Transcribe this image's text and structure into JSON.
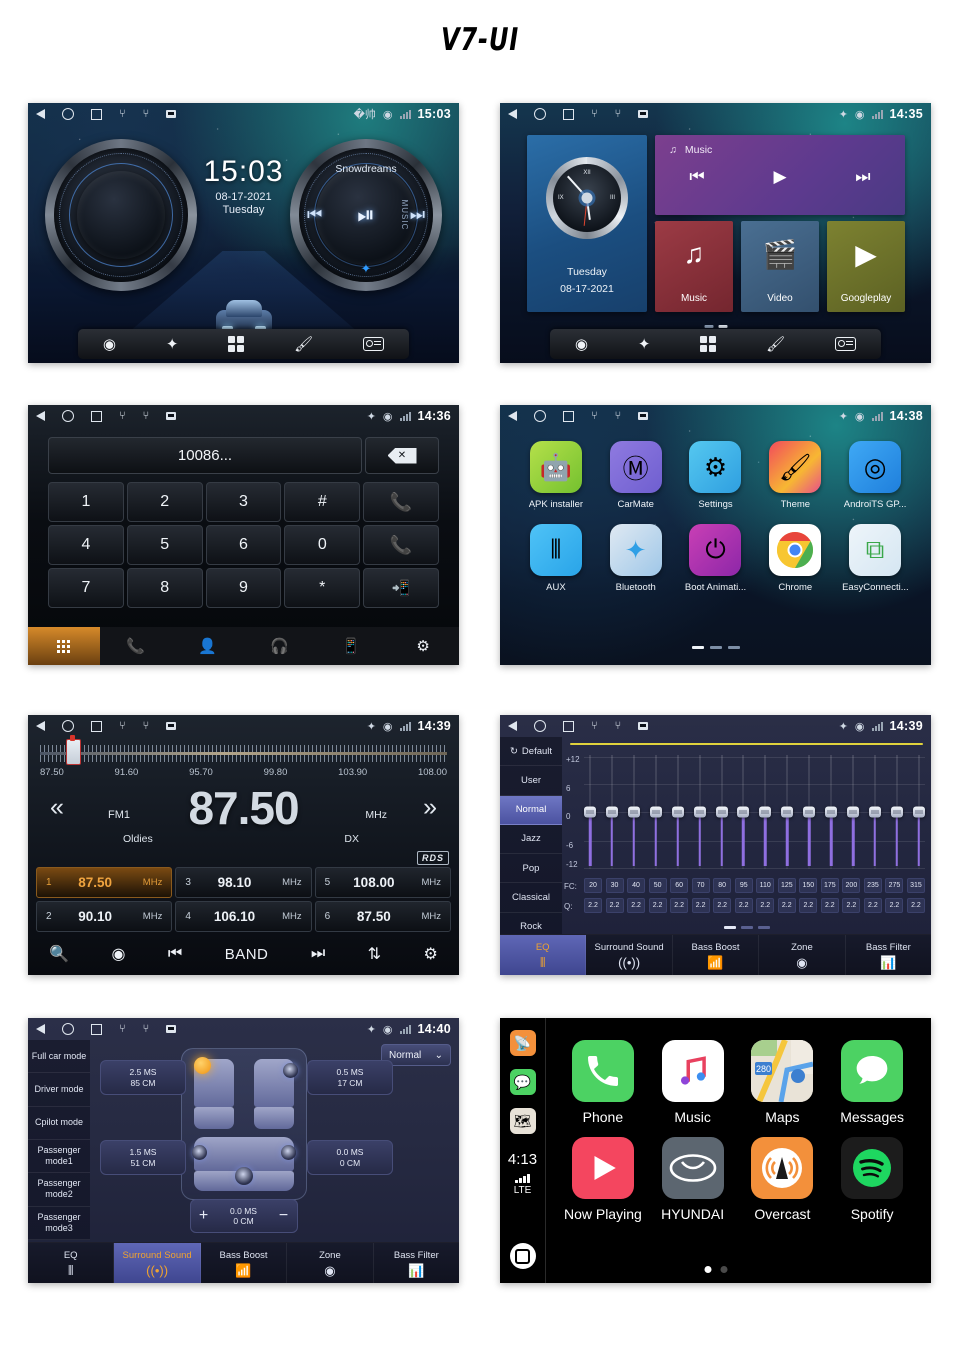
{
  "page": {
    "title": "V7-UI"
  },
  "status_icons": {
    "back": "back-triangle-icon",
    "home": "home-circle-icon",
    "recents": "recents-square-icon",
    "usb": "usb-icon",
    "sd": "sd-card-icon",
    "bluetooth": "bluetooth-icon",
    "location": "location-pin-icon",
    "signal": "signal-bars-icon"
  },
  "panels": {
    "home_knob": {
      "name": "Knob Home Screen",
      "clock_time": "15:03",
      "status_time": "15:03",
      "date": "08-17-2021",
      "weekday": "Tuesday",
      "track_title": "Snowdreams",
      "music_label": "MUSIC",
      "dock": [
        "navigation-icon",
        "bluetooth-icon",
        "apps-grid-icon",
        "theme-brush-icon",
        "radio-icon"
      ]
    },
    "home_tiles": {
      "name": "Tile Home Screen",
      "status_time": "14:35",
      "weekday": "Tuesday",
      "date": "08-17-2021",
      "clock_numerals": {
        "twelve": "XII",
        "three": "III",
        "nine": "IX"
      },
      "music_widget_label": "Music",
      "tiles": [
        {
          "label": "Music",
          "icon": "music-note-icon"
        },
        {
          "label": "Video",
          "icon": "video-clapper-icon"
        },
        {
          "label": "Googleplay",
          "icon": "play-triangle-icon"
        }
      ]
    },
    "dialer": {
      "name": "Bluetooth Dialer",
      "status_time": "14:36",
      "number": "10086...",
      "delete_icon": "backspace-icon",
      "keys": [
        "1",
        "2",
        "3",
        "#",
        "call",
        "4",
        "5",
        "6",
        "0",
        "end",
        "7",
        "8",
        "9",
        "*",
        "transfer"
      ],
      "tabs": [
        "keypad-icon",
        "call-log-icon",
        "contacts-icon",
        "bt-headset-icon",
        "bt-phone-icon",
        "bt-settings-icon"
      ]
    },
    "apps": {
      "name": "App Drawer",
      "status_time": "14:38",
      "items": [
        {
          "label": "APK installer",
          "icon": "android-robot-icon"
        },
        {
          "label": "CarMate",
          "icon": "carmate-pin-icon"
        },
        {
          "label": "Settings",
          "icon": "car-gear-icon"
        },
        {
          "label": "Theme",
          "icon": "paint-brush-icon"
        },
        {
          "label": "AndroiTS GP...",
          "icon": "gps-radar-icon"
        },
        {
          "label": "AUX",
          "icon": "aux-jack-icon"
        },
        {
          "label": "Bluetooth",
          "icon": "bluetooth-icon"
        },
        {
          "label": "Boot Animati...",
          "icon": "power-icon"
        },
        {
          "label": "Chrome",
          "icon": "chrome-icon"
        },
        {
          "label": "EasyConnecti...",
          "icon": "screen-mirror-icon"
        }
      ],
      "page_indicator": {
        "pages": 3,
        "current": 1
      }
    },
    "radio": {
      "name": "FM Radio",
      "status_time": "14:39",
      "frequency": "87.50",
      "unit": "MHz",
      "band": "FM1",
      "genre": "Oldies",
      "sensitivity": "DX",
      "rds": "RDS",
      "scale_labels": [
        "87.50",
        "91.60",
        "95.70",
        "99.80",
        "103.90",
        "108.00"
      ],
      "presets": [
        {
          "n": "1",
          "freq": "87.50",
          "unit": "MHz",
          "active": true
        },
        {
          "n": "3",
          "freq": "98.10",
          "unit": "MHz",
          "active": false
        },
        {
          "n": "5",
          "freq": "108.00",
          "unit": "MHz",
          "active": false
        },
        {
          "n": "2",
          "freq": "90.10",
          "unit": "MHz",
          "active": false
        },
        {
          "n": "4",
          "freq": "106.10",
          "unit": "MHz",
          "active": false
        },
        {
          "n": "6",
          "freq": "87.50",
          "unit": "MHz",
          "active": false
        }
      ],
      "band_button": "BAND",
      "bottom_icons": [
        "search-icon",
        "station-scan-icon",
        "prev-icon",
        "band-label",
        "next-icon",
        "equalizer-icon",
        "settings-gear-icon"
      ]
    },
    "equalizer": {
      "name": "Equalizer",
      "status_time": "14:39",
      "presets": [
        "Default",
        "User",
        "Normal",
        "Jazz",
        "Pop",
        "Classical",
        "Rock"
      ],
      "selected_preset": "Normal",
      "axis_labels": [
        "+12",
        "6",
        "0",
        "-6",
        "-12"
      ],
      "fc_label": "FC:",
      "q_label": "Q:",
      "fc_values": [
        "20",
        "30",
        "40",
        "50",
        "60",
        "70",
        "80",
        "95",
        "110",
        "125",
        "150",
        "175",
        "200",
        "235",
        "275",
        "315"
      ],
      "q_values": [
        "2.2",
        "2.2",
        "2.2",
        "2.2",
        "2.2",
        "2.2",
        "2.2",
        "2.2",
        "2.2",
        "2.2",
        "2.2",
        "2.2",
        "2.2",
        "2.2",
        "2.2",
        "2.2"
      ],
      "gain_values": [
        0,
        0,
        0,
        0,
        0,
        0,
        0,
        0,
        0,
        0,
        0,
        0,
        0,
        0,
        0,
        0
      ],
      "tabs": [
        {
          "label": "EQ",
          "icon": "eq-sliders-icon",
          "active": true
        },
        {
          "label": "Surround Sound",
          "icon": "surround-waves-icon",
          "active": false
        },
        {
          "label": "Bass Boost",
          "icon": "bass-chart-icon",
          "active": false
        },
        {
          "label": "Zone",
          "icon": "zone-target-icon",
          "active": false
        },
        {
          "label": "Bass Filter",
          "icon": "filter-bars-icon",
          "active": false
        }
      ],
      "page_indicator": {
        "pages": 3,
        "current": 1
      }
    },
    "surround": {
      "name": "Surround Sound",
      "status_time": "14:40",
      "modes": [
        "Full car mode",
        "Driver mode",
        "Cpilot mode",
        "Passenger mode1",
        "Passenger mode2",
        "Passenger mode3"
      ],
      "mode_select": "Normal",
      "delays": [
        {
          "pos": "front-left",
          "ms": "2.5 MS",
          "cm": "85 CM"
        },
        {
          "pos": "front-right",
          "ms": "0.5 MS",
          "cm": "17 CM"
        },
        {
          "pos": "rear-left",
          "ms": "1.5 MS",
          "cm": "51 CM"
        },
        {
          "pos": "rear-right",
          "ms": "0.0 MS",
          "cm": "0 CM"
        }
      ],
      "stepper": {
        "ms": "0.0 MS",
        "cm": "0 CM",
        "plus": "+",
        "minus": "−"
      },
      "tabs": [
        {
          "label": "EQ",
          "icon": "eq-sliders-icon",
          "active": false
        },
        {
          "label": "Surround Sound",
          "icon": "surround-waves-icon",
          "active": true
        },
        {
          "label": "Bass Boost",
          "icon": "bass-chart-icon",
          "active": false
        },
        {
          "label": "Zone",
          "icon": "zone-target-icon",
          "active": false
        },
        {
          "label": "Bass Filter",
          "icon": "filter-bars-icon",
          "active": false
        }
      ]
    },
    "carplay": {
      "name": "Apple CarPlay",
      "time": "4:13",
      "network": "LTE",
      "sidebar_icons": [
        "overcast-icon",
        "messages-icon",
        "maps-icon"
      ],
      "home_icon": "carplay-home-icon",
      "apps": [
        {
          "label": "Phone",
          "icon": "phone-handset-icon"
        },
        {
          "label": "Music",
          "icon": "music-note-icon"
        },
        {
          "label": "Maps",
          "icon": "maps-icon"
        },
        {
          "label": "Messages",
          "icon": "message-bubble-icon"
        },
        {
          "label": "Now Playing",
          "icon": "play-triangle-icon"
        },
        {
          "label": "HYUNDAI",
          "icon": "hyundai-logo-icon"
        },
        {
          "label": "Overcast",
          "icon": "overcast-tower-icon"
        },
        {
          "label": "Spotify",
          "icon": "spotify-icon"
        }
      ],
      "maps_shield": "280",
      "page_indicator": {
        "pages": 2,
        "current": 1
      }
    }
  }
}
